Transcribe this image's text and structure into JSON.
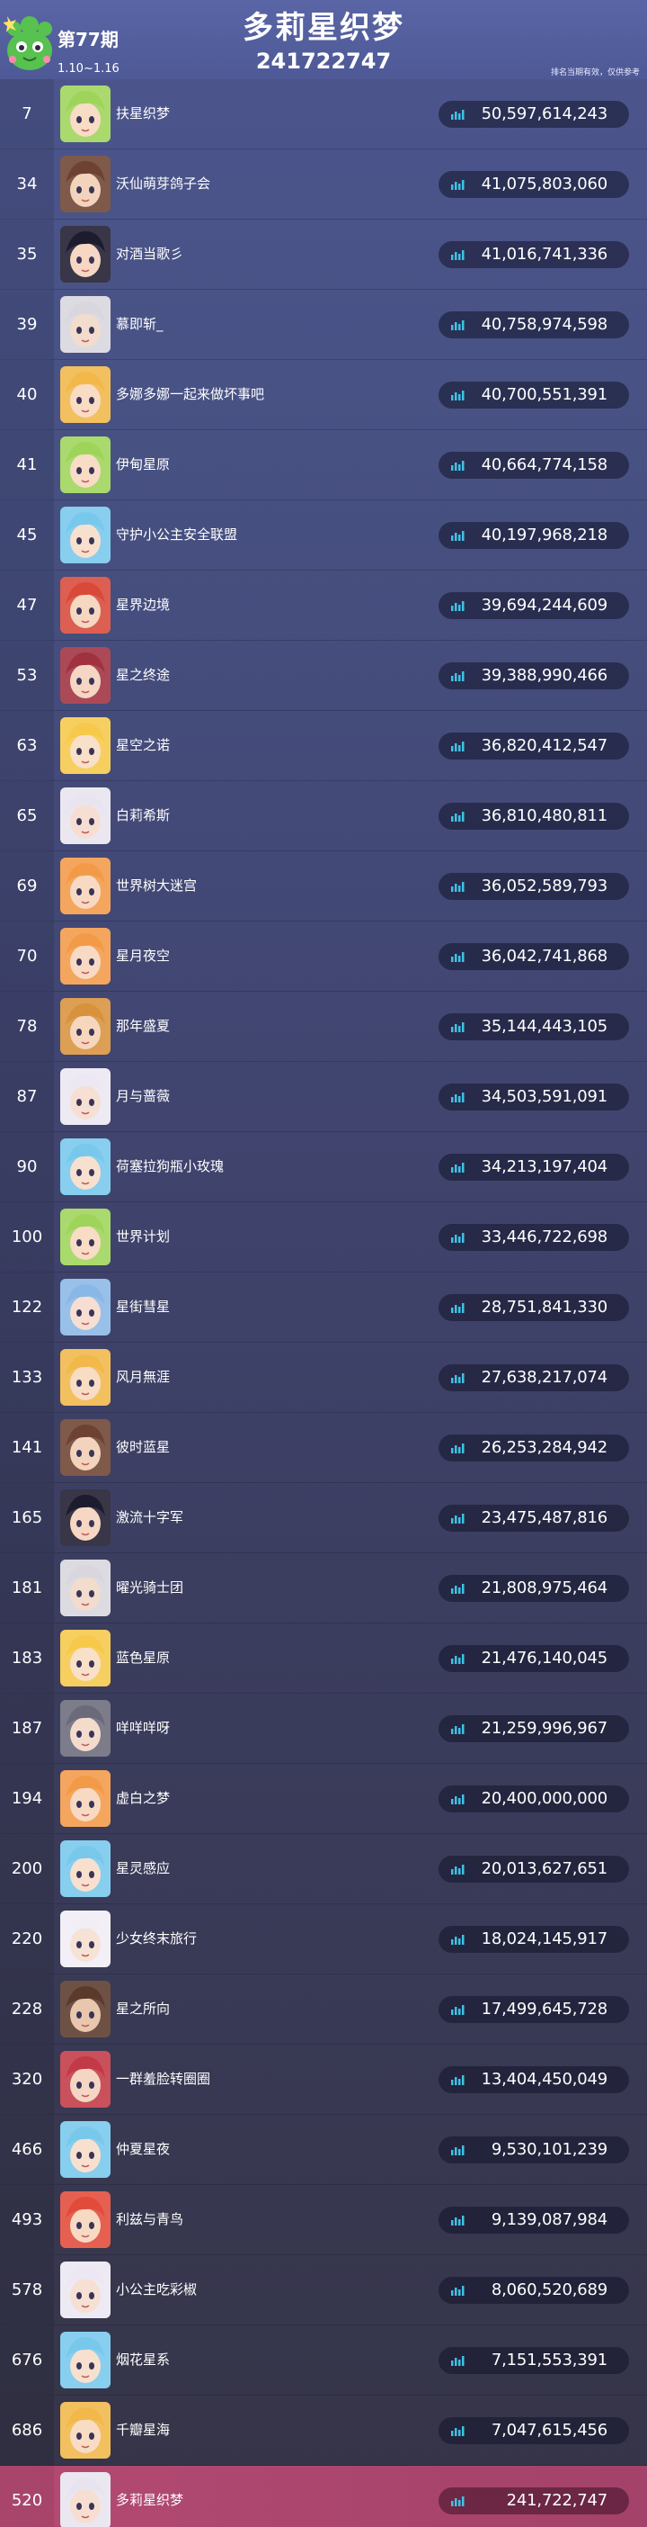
{
  "header": {
    "issue": "第77期",
    "dates": "1.10~1.16",
    "title": "多莉星织梦",
    "subtitle": "241722747",
    "note": "排名当期有效，仅供参考"
  },
  "colors": {
    "accent_bars": "#3ec3e6",
    "highlight_row": "#b44a72"
  },
  "rows": [
    {
      "rank": "7",
      "name": "扶星织梦",
      "score": "50,597,614,243",
      "hair": "#9fd45a",
      "skin": "#f7dcc6"
    },
    {
      "rank": "34",
      "name": "沃仙萌芽鸽子会",
      "score": "41,075,803,060",
      "hair": "#6e4232",
      "skin": "#f2d4bd"
    },
    {
      "rank": "35",
      "name": "对酒当歌彡",
      "score": "41,016,741,336",
      "hair": "#1d1b2e",
      "skin": "#f5d7c3"
    },
    {
      "rank": "39",
      "name": "慕即斩_",
      "score": "40,758,974,598",
      "hair": "#d9d6de",
      "skin": "#f1dccd"
    },
    {
      "rank": "40",
      "name": "多娜多娜一起来做坏事吧",
      "score": "40,700,551,391",
      "hair": "#f2b84a",
      "skin": "#f8dcc4"
    },
    {
      "rank": "41",
      "name": "伊甸星原",
      "score": "40,664,774,158",
      "hair": "#9fd45a",
      "skin": "#f7dcc6"
    },
    {
      "rank": "45",
      "name": "守护小公主安全联盟",
      "score": "40,197,968,218",
      "hair": "#78c8ec",
      "skin": "#f8e0cf"
    },
    {
      "rank": "47",
      "name": "星界边境",
      "score": "39,694,244,609",
      "hair": "#d8493a",
      "skin": "#f6d7c2"
    },
    {
      "rank": "53",
      "name": "星之终途",
      "score": "39,388,990,466",
      "hair": "#a0313f",
      "skin": "#f5d6c4"
    },
    {
      "rank": "63",
      "name": "星空之诺",
      "score": "36,820,412,547",
      "hair": "#f6c94a",
      "skin": "#f9e0c8"
    },
    {
      "rank": "65",
      "name": "白莉希斯",
      "score": "36,810,480,811",
      "hair": "#e9e4ef",
      "skin": "#f6dfd2"
    },
    {
      "rank": "69",
      "name": "世界树大迷宫",
      "score": "36,052,589,793",
      "hair": "#f39a48",
      "skin": "#f8dac4"
    },
    {
      "rank": "70",
      "name": "星月夜空",
      "score": "36,042,741,868",
      "hair": "#f39a48",
      "skin": "#f8dac4"
    },
    {
      "rank": "78",
      "name": "那年盛夏",
      "score": "35,144,443,105",
      "hair": "#d8923c",
      "skin": "#f6d6bd"
    },
    {
      "rank": "87",
      "name": "月与蔷薇",
      "score": "34,503,591,091",
      "hair": "#ece7f3",
      "skin": "#f6dfd3"
    },
    {
      "rank": "90",
      "name": "荷塞拉狗瓶小玫瑰",
      "score": "34,213,197,404",
      "hair": "#78c8ec",
      "skin": "#f8e0cf"
    },
    {
      "rank": "100",
      "name": "世界计划",
      "score": "33,446,722,698",
      "hair": "#9fd45a",
      "skin": "#f7dcc6"
    },
    {
      "rank": "122",
      "name": "星街彗星",
      "score": "28,751,841,330",
      "hair": "#8ab8e6",
      "skin": "#f6dfd2"
    },
    {
      "rank": "133",
      "name": "风月無涯",
      "score": "27,638,217,074",
      "hair": "#f2b84a",
      "skin": "#f8dcc4"
    },
    {
      "rank": "141",
      "name": "彼时蓝星",
      "score": "26,253,284,942",
      "hair": "#6e4232",
      "skin": "#f2d4bd"
    },
    {
      "rank": "165",
      "name": "激流十字军",
      "score": "23,475,487,816",
      "hair": "#1d1b2e",
      "skin": "#f5d7c3"
    },
    {
      "rank": "181",
      "name": "曜光骑士团",
      "score": "21,808,975,464",
      "hair": "#d9d6de",
      "skin": "#f1dccd"
    },
    {
      "rank": "183",
      "name": "蓝色星原",
      "score": "21,476,140,045",
      "hair": "#f6c94a",
      "skin": "#f9e0c8"
    },
    {
      "rank": "187",
      "name": "咩咩咩呀",
      "score": "21,259,996,967",
      "hair": "#6a6a7a",
      "skin": "#f4dccd"
    },
    {
      "rank": "194",
      "name": "虚白之梦",
      "score": "20,400,000,000",
      "hair": "#f39a48",
      "skin": "#f8dac4"
    },
    {
      "rank": "200",
      "name": "星灵感应",
      "score": "20,013,627,651",
      "hair": "#78c8ec",
      "skin": "#f8e0cf"
    },
    {
      "rank": "220",
      "name": "少女终末旅行",
      "score": "18,024,145,917",
      "hair": "#f1eef5",
      "skin": "#f7e2d6"
    },
    {
      "rank": "228",
      "name": "星之所向",
      "score": "17,499,645,728",
      "hair": "#5b3a2c",
      "skin": "#e9c7ae"
    },
    {
      "rank": "320",
      "name": "一群羞脸转圈圈",
      "score": "13,404,450,049",
      "hair": "#c23a46",
      "skin": "#f5d6c4"
    },
    {
      "rank": "466",
      "name": "仲夏星夜",
      "score": "9,530,101,239",
      "hair": "#78c8ec",
      "skin": "#f8e0cf"
    },
    {
      "rank": "493",
      "name": "利兹与青鸟",
      "score": "9,139,087,984",
      "hair": "#e24a3a",
      "skin": "#f8dac4"
    },
    {
      "rank": "578",
      "name": "小公主吃彩椒",
      "score": "8,060,520,689",
      "hair": "#ece7f3",
      "skin": "#f6dfd3"
    },
    {
      "rank": "676",
      "name": "烟花星系",
      "score": "7,151,553,391",
      "hair": "#78c8ec",
      "skin": "#f8e0cf"
    },
    {
      "rank": "686",
      "name": "千瓣星海",
      "score": "7,047,615,456",
      "hair": "#f2b84a",
      "skin": "#f8dcc4"
    },
    {
      "rank": "520",
      "name": "多莉星织梦",
      "score": "241,722,747",
      "hair": "#e8e4ef",
      "skin": "#f6dfd2",
      "highlight": true
    }
  ]
}
